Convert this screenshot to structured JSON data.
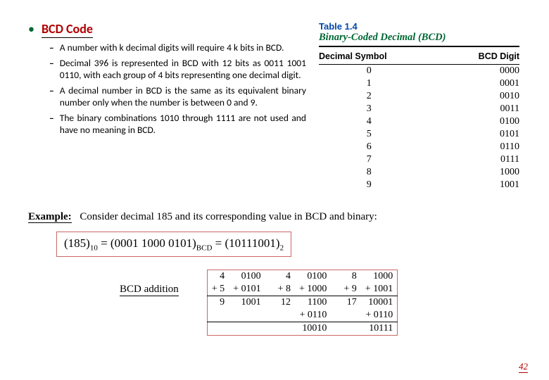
{
  "title": "BCD Code",
  "bullets": [
    "A number with k decimal digits will require 4 k bits in BCD.",
    "Decimal 396 is represented in BCD with 12 bits as 0011 1001 0110, with each group of 4 bits representing one decimal digit.",
    " A decimal number in BCD is the same as its equivalent binary number only when the number is between 0 and 9.",
    "The binary combinations 1010 through 1111 are not used and have no meaning in BCD."
  ],
  "table": {
    "num": "Table 1.4",
    "title": "Binary-Coded Decimal (BCD)",
    "head1": "Decimal Symbol",
    "head2": "BCD Digit",
    "rows": [
      {
        "d": "0",
        "b": "0000"
      },
      {
        "d": "1",
        "b": "0001"
      },
      {
        "d": "2",
        "b": "0010"
      },
      {
        "d": "3",
        "b": "0011"
      },
      {
        "d": "4",
        "b": "0100"
      },
      {
        "d": "5",
        "b": "0101"
      },
      {
        "d": "6",
        "b": "0110"
      },
      {
        "d": "7",
        "b": "0111"
      },
      {
        "d": "8",
        "b": "1000"
      },
      {
        "d": "9",
        "b": "1001"
      }
    ]
  },
  "example": {
    "label": "Example:",
    "text": "Consider decimal 185 and its corresponding value in BCD and binary:",
    "eq": {
      "a_open": "(",
      "a_val": "185",
      "a_close": ")",
      "a_sub": "10",
      "eq1": " = (",
      "b_val": "0001 1000 0101",
      "b_close": ")",
      "b_sub": "BCD",
      "eq2": " = (",
      "c_val": "10111001",
      "c_close": ")",
      "c_sub": "2"
    }
  },
  "addition_label": "BCD addition",
  "addition": {
    "row1": [
      "4",
      "0100",
      "",
      "4",
      "0100",
      "",
      "8",
      "1000"
    ],
    "row2": [
      "+ 5",
      "+ 0101",
      "",
      "+ 8",
      "+ 1000",
      "",
      "+ 9",
      "+ 1001"
    ],
    "row3": [
      "9",
      "1001",
      "",
      "12",
      "1100",
      "",
      "17",
      "10001"
    ],
    "row4": [
      "",
      "",
      "",
      "",
      "+ 0110",
      "",
      "",
      "+ 0110"
    ],
    "row5": [
      "",
      "",
      "",
      "",
      "10010",
      "",
      "",
      "10111"
    ]
  },
  "page": "42"
}
